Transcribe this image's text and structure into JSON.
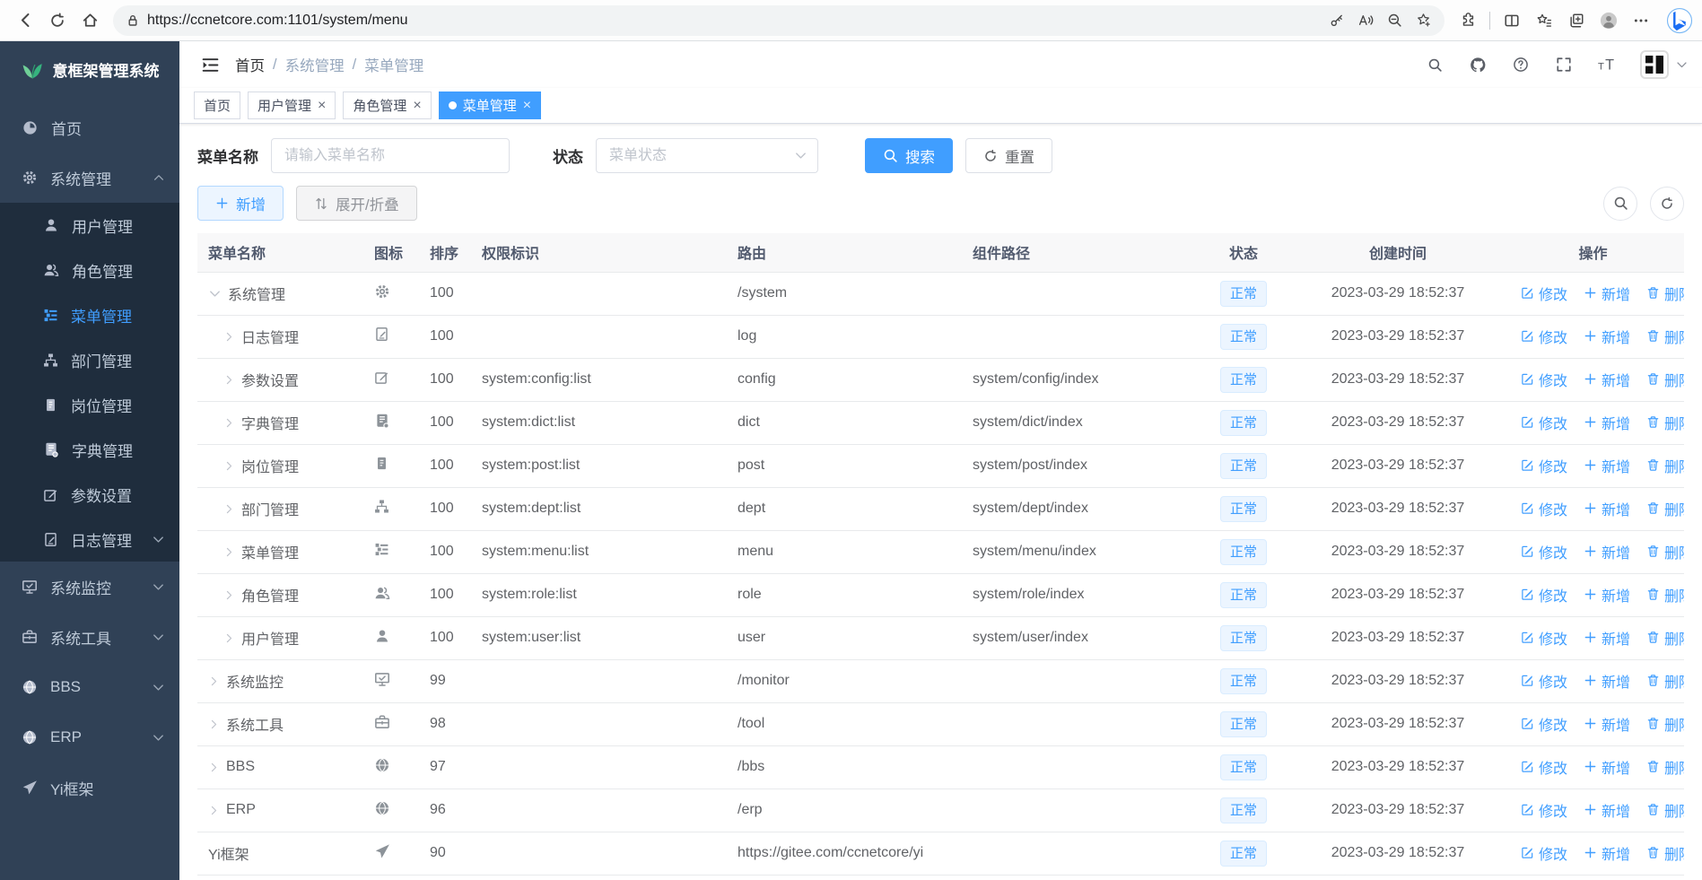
{
  "browser": {
    "url": "https://ccnetcore.com:1101/system/menu",
    "left_icons": [
      "back",
      "refresh",
      "home"
    ],
    "pill_leading_icon": "lock",
    "pill_trailing_icons": [
      "key",
      "read-aloud",
      "zoom-out",
      "star-plus"
    ],
    "right_icons": [
      "extensions",
      "split-screen",
      "favorites-bar",
      "collections",
      "profile",
      "more"
    ],
    "corner_icon": "bing"
  },
  "sidebar": {
    "logo_icon": "leaf",
    "logo_title": "意框架管理系统",
    "items": [
      {
        "key": "home",
        "label": "首页",
        "icon": "dashboard",
        "type": "top"
      },
      {
        "key": "system",
        "label": "系统管理",
        "icon": "gear",
        "type": "top",
        "chevron": "up"
      },
      {
        "key": "user",
        "label": "用户管理",
        "icon": "user",
        "type": "sub"
      },
      {
        "key": "role",
        "label": "角色管理",
        "icon": "peoples",
        "type": "sub"
      },
      {
        "key": "menu",
        "label": "菜单管理",
        "icon": "tree-table",
        "type": "sub",
        "active": true
      },
      {
        "key": "dept",
        "label": "部门管理",
        "icon": "tree",
        "type": "sub"
      },
      {
        "key": "post",
        "label": "岗位管理",
        "icon": "post",
        "type": "sub"
      },
      {
        "key": "dict",
        "label": "字典管理",
        "icon": "dict",
        "type": "sub"
      },
      {
        "key": "config",
        "label": "参数设置",
        "icon": "edit",
        "type": "sub"
      },
      {
        "key": "log",
        "label": "日志管理",
        "icon": "log",
        "type": "sub",
        "chevron": "down"
      },
      {
        "key": "monitor",
        "label": "系统监控",
        "icon": "monitor",
        "type": "top",
        "chevron": "down"
      },
      {
        "key": "tool",
        "label": "系统工具",
        "icon": "tool",
        "type": "top",
        "chevron": "down"
      },
      {
        "key": "bbs",
        "label": "BBS",
        "icon": "globe",
        "type": "top",
        "chevron": "down"
      },
      {
        "key": "erp",
        "label": "ERP",
        "icon": "globe",
        "type": "top",
        "chevron": "down"
      },
      {
        "key": "yiframework",
        "label": "Yi框架",
        "icon": "send",
        "type": "top"
      }
    ]
  },
  "navbar": {
    "breadcrumb": [
      "首页",
      "系统管理",
      "菜单管理"
    ],
    "right_icons": [
      "search",
      "github",
      "question",
      "fullscreen",
      "text-size"
    ],
    "avatar_icon": "avatar-logo"
  },
  "tabs": [
    {
      "key": "home",
      "label": "首页",
      "closable": false,
      "active": false
    },
    {
      "key": "user",
      "label": "用户管理",
      "closable": true,
      "active": false
    },
    {
      "key": "role",
      "label": "角色管理",
      "closable": true,
      "active": false
    },
    {
      "key": "menu",
      "label": "菜单管理",
      "closable": true,
      "active": true
    }
  ],
  "search_form": {
    "name_label": "菜单名称",
    "name_placeholder": "请输入菜单名称",
    "name_value": "",
    "status_label": "状态",
    "status_placeholder": "菜单状态",
    "status_value": "",
    "search_label": "搜索",
    "reset_label": "重置"
  },
  "toolbar": {
    "add_label": "新增",
    "expand_label": "展开/折叠",
    "right_icons": [
      "search",
      "refresh"
    ]
  },
  "table": {
    "columns": [
      {
        "label": "菜单名称",
        "align": "left"
      },
      {
        "label": "图标",
        "align": "left"
      },
      {
        "label": "排序",
        "align": "left"
      },
      {
        "label": "权限标识",
        "align": "left"
      },
      {
        "label": "路由",
        "align": "left"
      },
      {
        "label": "组件路径",
        "align": "left"
      },
      {
        "label": "状态",
        "align": "center"
      },
      {
        "label": "创建时间",
        "align": "center"
      },
      {
        "label": "操作",
        "align": "center"
      }
    ],
    "actions": [
      {
        "key": "edit",
        "label": "修改",
        "icon": "edit-pen"
      },
      {
        "key": "add",
        "label": "新增",
        "icon": "plus"
      },
      {
        "key": "delete",
        "label": "删除",
        "icon": "delete"
      }
    ],
    "status_normal": "正常",
    "rows": [
      {
        "name": "系统管理",
        "icon": "gear",
        "level": 0,
        "arrow": "down",
        "order": "100",
        "perms": "",
        "path": "/system",
        "component": "",
        "status": "正常",
        "created": "2023-03-29 18:52:37"
      },
      {
        "name": "日志管理",
        "icon": "log",
        "level": 1,
        "arrow": "right",
        "order": "100",
        "perms": "",
        "path": "log",
        "component": "",
        "status": "正常",
        "created": "2023-03-29 18:52:37"
      },
      {
        "name": "参数设置",
        "icon": "edit",
        "level": 1,
        "arrow": "right",
        "order": "100",
        "perms": "system:config:list",
        "path": "config",
        "component": "system/config/index",
        "status": "正常",
        "created": "2023-03-29 18:52:37"
      },
      {
        "name": "字典管理",
        "icon": "dict",
        "level": 1,
        "arrow": "right",
        "order": "100",
        "perms": "system:dict:list",
        "path": "dict",
        "component": "system/dict/index",
        "status": "正常",
        "created": "2023-03-29 18:52:37"
      },
      {
        "name": "岗位管理",
        "icon": "post",
        "level": 1,
        "arrow": "right",
        "order": "100",
        "perms": "system:post:list",
        "path": "post",
        "component": "system/post/index",
        "status": "正常",
        "created": "2023-03-29 18:52:37"
      },
      {
        "name": "部门管理",
        "icon": "tree",
        "level": 1,
        "arrow": "right",
        "order": "100",
        "perms": "system:dept:list",
        "path": "dept",
        "component": "system/dept/index",
        "status": "正常",
        "created": "2023-03-29 18:52:37"
      },
      {
        "name": "菜单管理",
        "icon": "tree-table",
        "level": 1,
        "arrow": "right",
        "order": "100",
        "perms": "system:menu:list",
        "path": "menu",
        "component": "system/menu/index",
        "status": "正常",
        "created": "2023-03-29 18:52:37"
      },
      {
        "name": "角色管理",
        "icon": "peoples",
        "level": 1,
        "arrow": "right",
        "order": "100",
        "perms": "system:role:list",
        "path": "role",
        "component": "system/role/index",
        "status": "正常",
        "created": "2023-03-29 18:52:37"
      },
      {
        "name": "用户管理",
        "icon": "user",
        "level": 1,
        "arrow": "right",
        "order": "100",
        "perms": "system:user:list",
        "path": "user",
        "component": "system/user/index",
        "status": "正常",
        "created": "2023-03-29 18:52:37"
      },
      {
        "name": "系统监控",
        "icon": "monitor",
        "level": 0,
        "arrow": "right",
        "order": "99",
        "perms": "",
        "path": "/monitor",
        "component": "",
        "status": "正常",
        "created": "2023-03-29 18:52:37"
      },
      {
        "name": "系统工具",
        "icon": "tool",
        "level": 0,
        "arrow": "right",
        "order": "98",
        "perms": "",
        "path": "/tool",
        "component": "",
        "status": "正常",
        "created": "2023-03-29 18:52:37"
      },
      {
        "name": "BBS",
        "icon": "globe",
        "level": 0,
        "arrow": "right",
        "order": "97",
        "perms": "",
        "path": "/bbs",
        "component": "",
        "status": "正常",
        "created": "2023-03-29 18:52:37"
      },
      {
        "name": "ERP",
        "icon": "globe",
        "level": 0,
        "arrow": "right",
        "order": "96",
        "perms": "",
        "path": "/erp",
        "component": "",
        "status": "正常",
        "created": "2023-03-29 18:52:37"
      },
      {
        "name": "Yi框架",
        "icon": "send",
        "level": 0,
        "arrow": "none",
        "order": "90",
        "perms": "",
        "path": "https://gitee.com/ccnetcore/yi",
        "component": "",
        "status": "正常",
        "created": "2023-03-29 18:52:37"
      }
    ]
  },
  "colors": {
    "accent": "#409eff",
    "sidebar_bg": "#304156",
    "submenu_bg": "#1f2d3d",
    "tag_bg": "#ecf5ff",
    "active_tab_bg": "#409eff"
  }
}
